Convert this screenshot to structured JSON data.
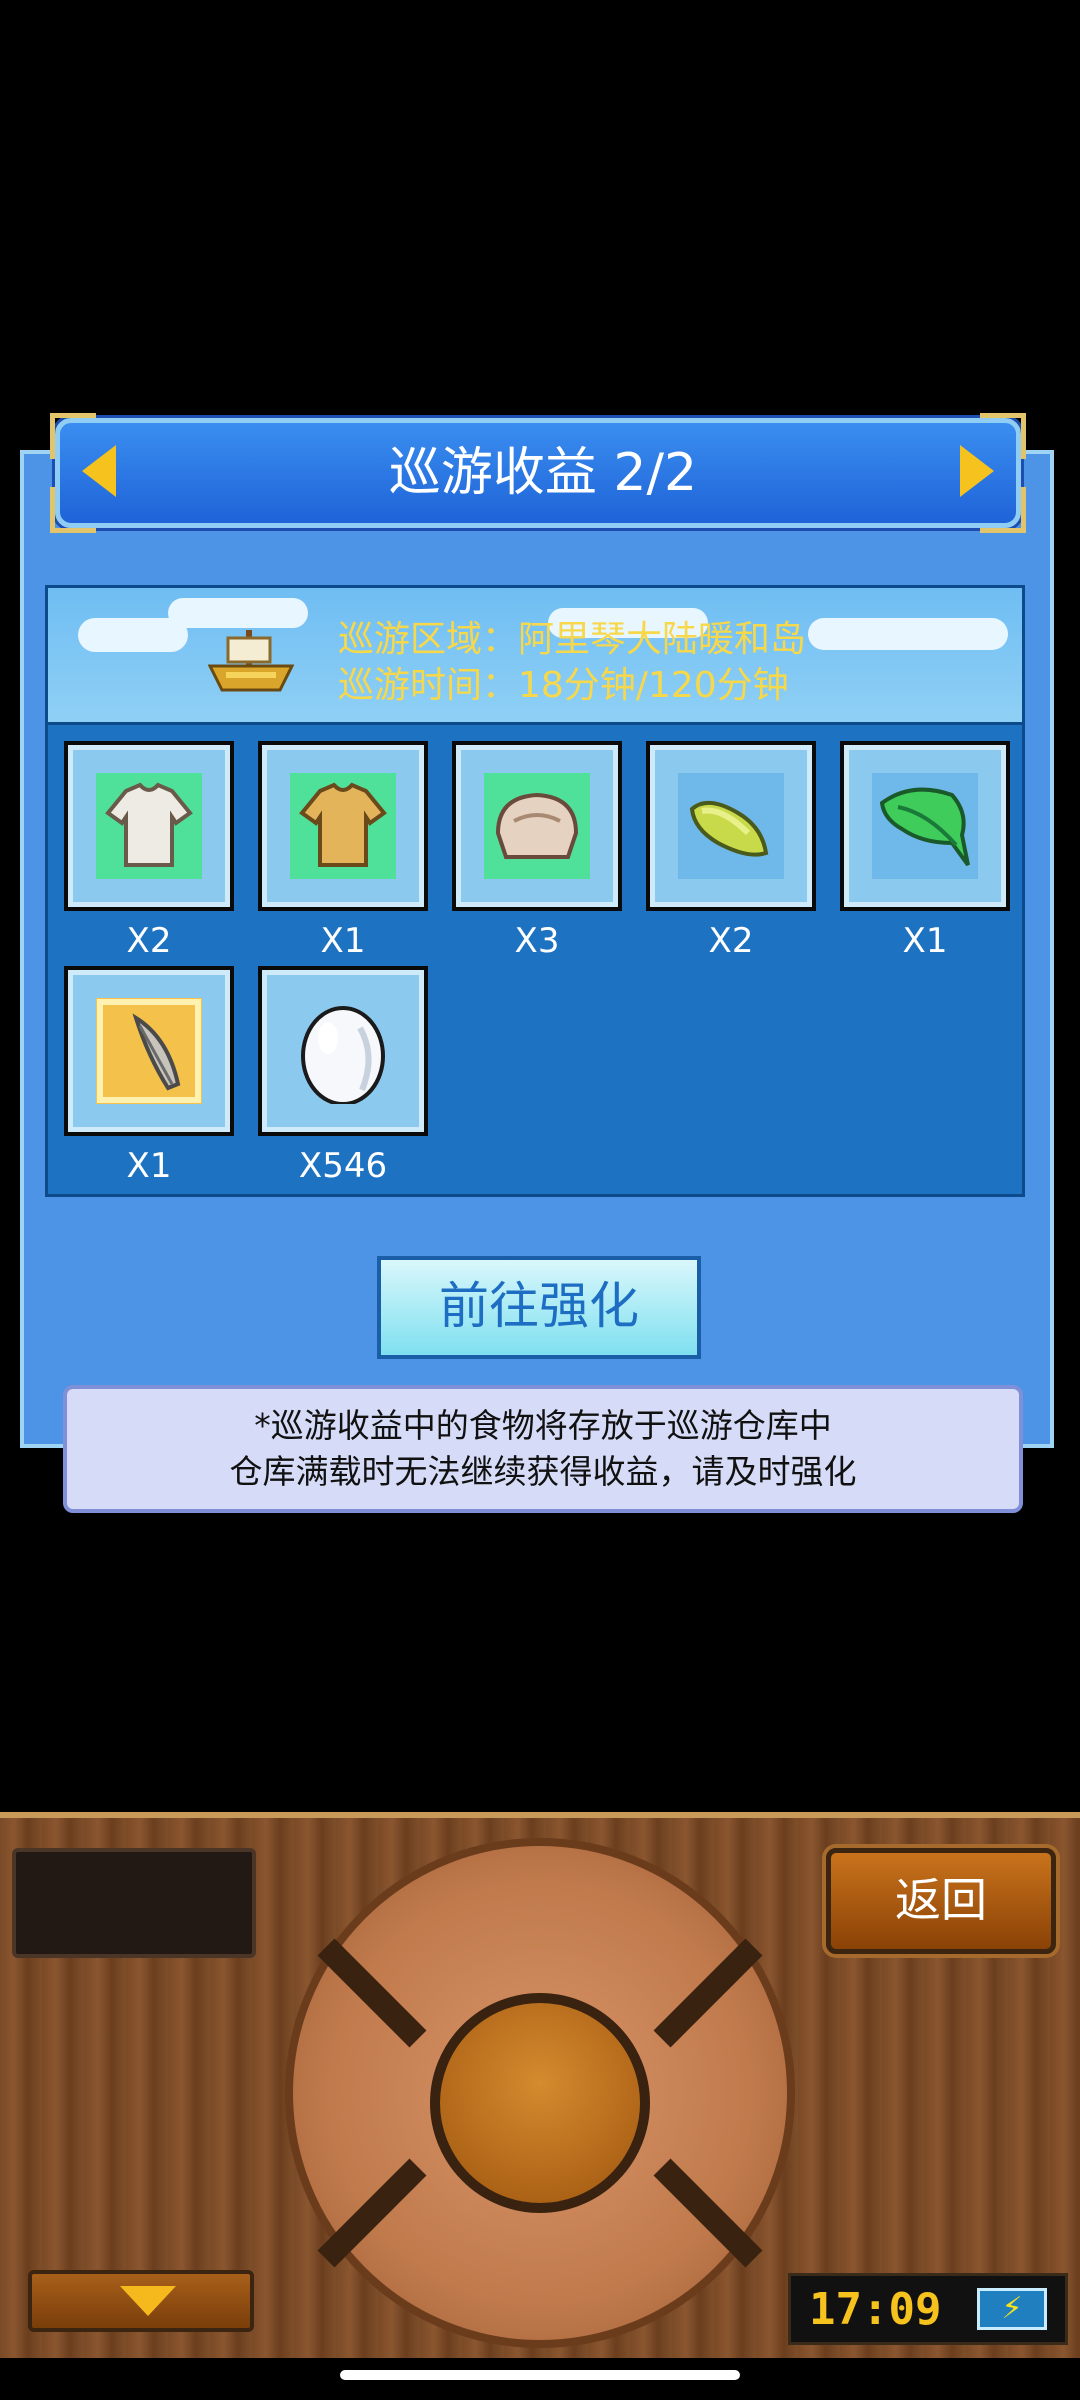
{
  "dialog": {
    "title": "巡游收益 2/2",
    "info": {
      "area": "巡游区域：阿里琴大陆暖和岛",
      "time": "巡游时间：18分钟/120分钟"
    },
    "items": [
      {
        "icon": "white-shirt-icon",
        "qty": "X2"
      },
      {
        "icon": "yellow-shirt-icon",
        "qty": "X1"
      },
      {
        "icon": "bread-icon",
        "qty": "X3"
      },
      {
        "icon": "corn-icon",
        "qty": "X2"
      },
      {
        "icon": "green-leaf-icon",
        "qty": "X1"
      },
      {
        "icon": "feather-quill-icon",
        "qty": "X1"
      },
      {
        "icon": "egg-icon",
        "qty": "X546"
      }
    ],
    "go_button": "前往强化",
    "note": {
      "line1": "*巡游收益中的食物将存放于巡游仓库中",
      "line2": "仓库满载时无法继续获得收益，请及时强化"
    }
  },
  "controls": {
    "back_label": "返回",
    "clock": "17:09",
    "battery_glyph": "⚡"
  },
  "colors": {
    "dialog_bg": "#4d94e6",
    "panel_bg": "#1d72c2",
    "info_text": "#f8d84b",
    "arrow": "#f6c21d"
  }
}
